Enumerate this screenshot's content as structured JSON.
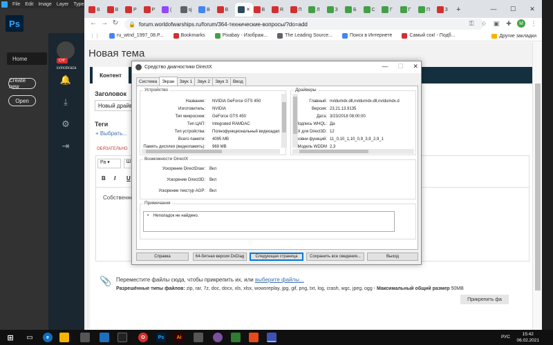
{
  "photoshop": {
    "menu": [
      "File",
      "Edit",
      "Image",
      "Layer",
      "Type"
    ],
    "logo": "Ps",
    "home_label": "Home",
    "create_label": "Create new",
    "open_label": "Open"
  },
  "browser": {
    "tabs": [
      {
        "label": "В",
        "color": "#d32f2f"
      },
      {
        "label": "В",
        "color": "#d32f2f"
      },
      {
        "label": "Р",
        "color": "#d32f2f"
      },
      {
        "label": "Р",
        "color": "#d32f2f"
      },
      {
        "label": "(",
        "color": "#9146ff"
      },
      {
        "label": "sj",
        "color": "#5f6368"
      },
      {
        "label": "В",
        "color": "#4285f4"
      },
      {
        "label": "В",
        "color": "#d32f2f"
      },
      {
        "label": "✕",
        "color": "#2e4a5a",
        "active": true
      },
      {
        "label": "В",
        "color": "#d32f2f"
      },
      {
        "label": "R",
        "color": "#d32f2f"
      },
      {
        "label": "П",
        "color": "#d32f2f"
      },
      {
        "label": "Л",
        "color": "#43a047"
      },
      {
        "label": "З",
        "color": "#43a047"
      },
      {
        "label": "Б",
        "color": "#43a047"
      },
      {
        "label": "С",
        "color": "#43a047"
      },
      {
        "label": "Г",
        "color": "#43a047"
      },
      {
        "label": "Г",
        "color": "#43a047"
      },
      {
        "label": "П",
        "color": "#43a047"
      },
      {
        "label": "З",
        "color": "#d32f2f"
      }
    ],
    "url": "forum.worldofwarships.ru/forum/364-технические-вопросы/?do=add",
    "profile_initial": "M",
    "bookmarks": [
      {
        "label": "ru_wtnd_1997_08.P...",
        "color": "#4285f4"
      },
      {
        "label": "Bookmarks",
        "color": "#d32f2f"
      },
      {
        "label": "Pixabay - Изображ...",
        "color": "#43a047"
      },
      {
        "label": "The Leading Source...",
        "color": "#5f6368"
      },
      {
        "label": "Поиск в Интернете",
        "color": "#4285f4"
      },
      {
        "label": "Самый сок! - Подб...",
        "color": "#d32f2f"
      }
    ],
    "other_bookmarks": "Другие закладки"
  },
  "forum": {
    "page_title": "Новая тема",
    "tab_content": "Контент",
    "title_label": "Заголовок",
    "title_value": "Новый драйв",
    "tags_label": "Теги",
    "choose_tags": "+ Выбрать...",
    "required": "ОБЯЗАТЕЛЬНО",
    "font_size": "Ра",
    "font_size2": "Ш",
    "bold": "B",
    "italic": "I",
    "underline": "U",
    "editor_text": "Собственно",
    "attach_text": "Переместите файлы сюда, чтобы прикрепить их, или ",
    "attach_link": "выберите файлы...",
    "allowed_label": "Разрешённые типы файлов:",
    "allowed_types": " zip, rar, 7z, doc, docx, xls, xlsx, wowsreplay, jpg, gif, png, txt, log, crash, wgc, jpeg, ogg",
    "max_size_label": " · Максимальный общий размер",
    "max_size": " 50MB",
    "attach_button": "Прикрепить фа",
    "user_badge": "СНГ",
    "username": "svinobraza"
  },
  "dxdiag": {
    "title": "Средство диагностики DirectX",
    "tabs": [
      "Система",
      "Экран",
      "Звук 1",
      "Звук 2",
      "Звук 3",
      "Ввод"
    ],
    "active_tab": 1,
    "device_title": "Устройство",
    "device": [
      {
        "k": "Название:",
        "v": "NVIDIA GeForce GTS 450"
      },
      {
        "k": "Изготовитель:",
        "v": "NVIDIA"
      },
      {
        "k": "Тип микросхем:",
        "v": "GeForce GTS 450"
      },
      {
        "k": "Тип ЦАП:",
        "v": "Integrated RAMDAC"
      },
      {
        "k": "Тип устройства:",
        "v": "Полнофункциональный видеоадап"
      },
      {
        "k": "Всего памяти:",
        "v": "4095 MB"
      },
      {
        "k": "Память дисплея (видеопамять):",
        "v": "969 MB"
      }
    ],
    "drivers_title": "Драйверы",
    "drivers": [
      {
        "k": "Главный:",
        "v": "nvldumdx.dll,nvldumdx.dll,nvldumdx.d"
      },
      {
        "k": "Версия:",
        "v": "23.21.13.9135"
      },
      {
        "k": "Дата:",
        "v": "3/23/2018 08:00:00"
      },
      {
        "k": "Подпись WHQL:",
        "v": "Да"
      },
      {
        "k": "DDI для Direct3D:",
        "v": "12"
      },
      {
        "k": "Уровни функций:",
        "v": "11_0,10_1,10_0,9_3,9_2,9_1"
      },
      {
        "k": "Модель WDDM",
        "v": "2.3"
      }
    ],
    "features_title": "Возможности DirectX",
    "features": [
      {
        "k": "Ускорение DirectDraw:",
        "v": "Вкл"
      },
      {
        "k": "Ускорение Direct3D:",
        "v": "Вкл"
      },
      {
        "k": "Ускорение текстур AGP:",
        "v": "Вкл"
      }
    ],
    "notes_title": "Примечания",
    "notes": "Неполадок не найдено.",
    "buttons": [
      "Справка",
      "64-битная версия DxDiag",
      "Следующая страница",
      "Сохранить все сведения...",
      "Выход"
    ]
  },
  "taskbar": {
    "lang": "РУС",
    "time": "15:42",
    "date": "06.02.2021"
  }
}
